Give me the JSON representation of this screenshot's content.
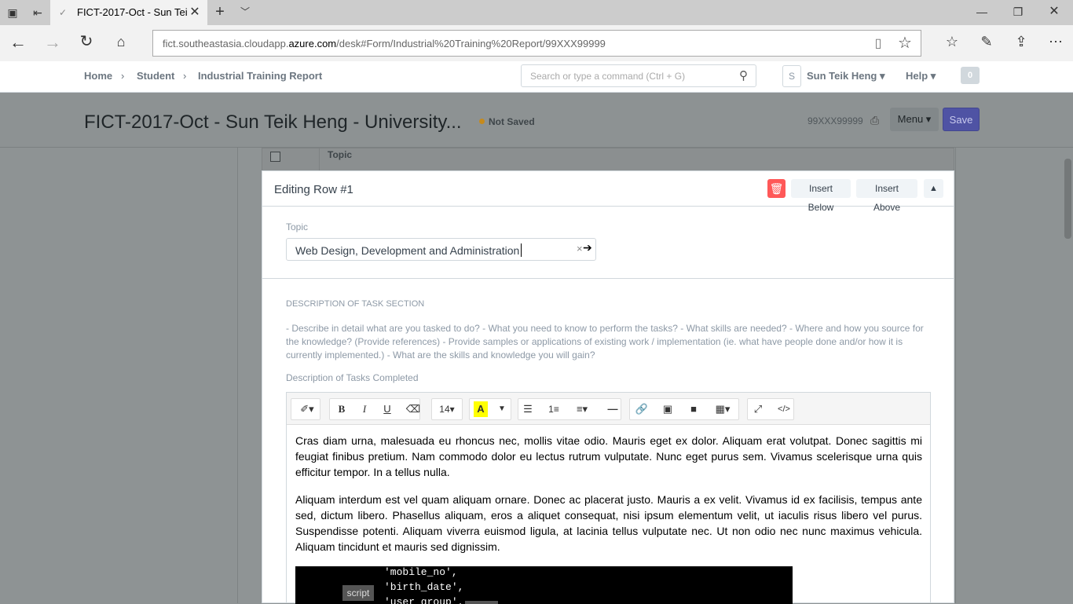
{
  "browser": {
    "tab_title": "FICT-2017-Oct - Sun Tei",
    "url_prefix": "fict.southeastasia.cloudapp.",
    "url_domain": "azure.com",
    "url_suffix": "/desk#Form/Industrial%20Training%20Report/99XXX99999"
  },
  "navbar": {
    "breadcrumbs": [
      "Home",
      "Student",
      "Industrial Training Report"
    ],
    "search_placeholder": "Search or type a command (Ctrl + G)",
    "avatar_letter": "S",
    "user_name": "Sun Teik Heng",
    "help_label": "Help",
    "notification_count": "0"
  },
  "page_head": {
    "title": "FICT-2017-Oct - Sun Teik Heng - University...",
    "status": "Not Saved",
    "doc_id": "99XXX99999",
    "menu_label": "Menu",
    "save_label": "Save"
  },
  "grid": {
    "column_topic": "Topic"
  },
  "editing_row": {
    "title": "Editing Row #1",
    "insert_below": "Insert Below",
    "insert_above": "Insert Above",
    "topic_label": "Topic",
    "topic_value": "Web Design, Development and Administration",
    "section_heading": "DESCRIPTION OF TASK SECTION",
    "section_help": "- Describe in detail what are you tasked to do? - What you need to know to perform the tasks? - What skills are needed? - Where and how you source for the knowledge? (Provide references) - Provide samples or applications of existing work / implementation (ie. what have people done and/or how it is currently implemented.) - What are the skills and knowledge you will gain?",
    "description_label": "Description of Tasks Completed"
  },
  "editor": {
    "font_size": "14",
    "paragraphs": [
      "Cras diam urna, malesuada eu rhoncus nec, mollis vitae odio. Mauris eget ex dolor. Aliquam erat volutpat. Donec sagittis mi feugiat finibus pretium. Nam commodo dolor eu lectus rutrum vulputate. Nunc eget purus sem. Vivamus scelerisque urna quis efficitur tempor. In a tellus nulla.",
      "Aliquam interdum est vel quam aliquam ornare. Donec ac placerat justo. Mauris a ex velit. Vivamus id ex facilisis, tempus ante sed, dictum libero. Phasellus aliquam, eros a aliquet consequat, nisi ipsum elementum velit, ut iaculis risus libero vel purus. Suspendisse potenti. Aliquam viverra euismod ligula, at lacinia tellus vulputate nec. Ut non odio nec nunc maximus vehicula. Aliquam tincidunt et mauris sed dignissim."
    ],
    "code_lines": [
      "'mobile_no',",
      "'birth_date',",
      "'user_group',"
    ],
    "code_tag": "script"
  },
  "colors": {
    "primary": "#5e64ff",
    "danger": "#ff5858",
    "not_saved": "#ffa00a"
  }
}
